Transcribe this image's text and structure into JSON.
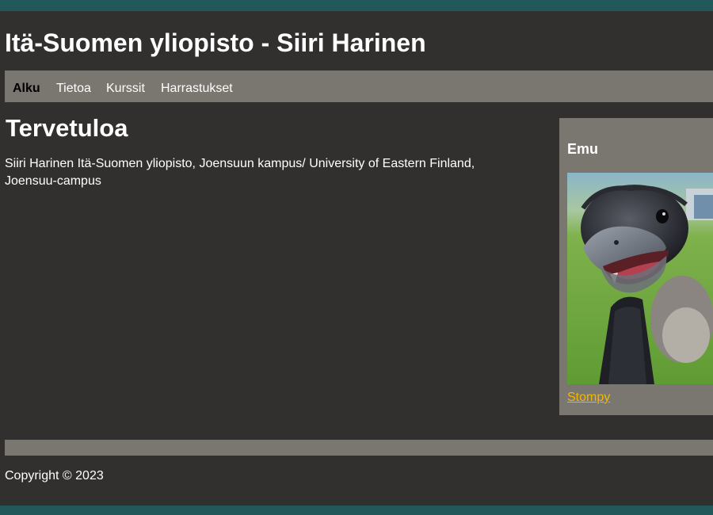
{
  "header": {
    "title": "Itä-Suomen yliopisto - Siiri Harinen"
  },
  "nav": {
    "items": [
      {
        "label": "Alku",
        "active": true
      },
      {
        "label": "Tietoa",
        "active": false
      },
      {
        "label": "Kurssit",
        "active": false
      },
      {
        "label": "Harrastukset",
        "active": false
      }
    ]
  },
  "main": {
    "heading": "Tervetuloa",
    "intro": "Siiri Harinen Itä-Suomen yliopisto, Joensuun kampus/ University of Eastern Finland, Joensuu-campus"
  },
  "sidebar": {
    "title": "Emu",
    "image_subject": "emu-photo",
    "link_text": "Stompy"
  },
  "footer": {
    "copyright": "Copyright © 2023"
  },
  "colors": {
    "outer_background": "#23585a",
    "page_background": "#32302e",
    "bar_gray": "#7a7771",
    "link_yellow": "#f2b705",
    "text": "#ffffff"
  }
}
